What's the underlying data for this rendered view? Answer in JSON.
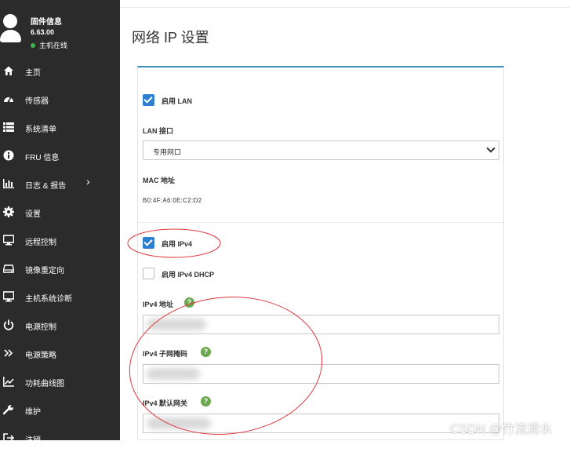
{
  "sidebar": {
    "profile": {
      "title": "固件信息",
      "version": "6.63.00",
      "status": "主机在线",
      "status_color": "#3cb44b"
    },
    "items": [
      {
        "label": "主页",
        "icon": "home-icon"
      },
      {
        "label": "传感器",
        "icon": "dashboard-icon"
      },
      {
        "label": "系统清单",
        "icon": "list-icon"
      },
      {
        "label": "FRU 信息",
        "icon": "info-icon"
      },
      {
        "label": "日志 & 报告",
        "icon": "bar-chart-icon",
        "has_submenu": true
      },
      {
        "label": "设置",
        "icon": "gear-icon"
      },
      {
        "label": "远程控制",
        "icon": "monitor-icon"
      },
      {
        "label": "镜像重定向",
        "icon": "drive-icon"
      },
      {
        "label": "主机系统诊断",
        "icon": "monitor-icon"
      },
      {
        "label": "电源控制",
        "icon": "power-icon"
      },
      {
        "label": "电源策略",
        "icon": "double-chevron-icon"
      },
      {
        "label": "功耗曲线图",
        "icon": "line-chart-icon"
      },
      {
        "label": "维护",
        "icon": "wrench-icon"
      },
      {
        "label": "注销",
        "icon": "logout-icon"
      }
    ],
    "submenu_arrow": "›"
  },
  "main": {
    "title": "网络 IP 设置",
    "accent": "#3c8dbc",
    "form": {
      "enable_lan": {
        "label": "启用 LAN",
        "checked": true
      },
      "lan_interface": {
        "label": "LAN 接口",
        "value": "专用网口"
      },
      "mac": {
        "label": "MAC 地址",
        "value": "B0:4F:A6:0E:C2:D2"
      },
      "enable_ipv4": {
        "label": "启用 IPv4",
        "checked": true
      },
      "enable_ipv4_dhcp": {
        "label": "启用 IPv4 DHCP",
        "checked": false
      },
      "ipv4_address": {
        "label": "IPv4 地址"
      },
      "ipv4_subnet": {
        "label": "IPv4 子网掩码"
      },
      "ipv4_gateway": {
        "label": "IPv4 默认网关"
      },
      "help_glyph": "?"
    }
  },
  "watermark": "CSDN @竹流清水",
  "annotation_color": "#e0393e"
}
